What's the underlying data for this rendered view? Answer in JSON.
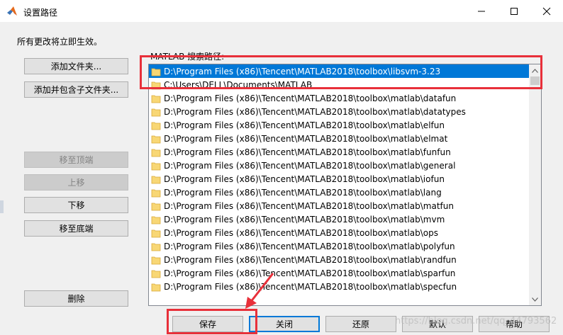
{
  "window": {
    "title": "设置路径",
    "icon": "matlab-logo-icon",
    "controls": [
      "minimize-icon",
      "maximize-icon",
      "close-icon"
    ]
  },
  "notice": "所有更改将立即生效。",
  "left_buttons": {
    "add_folder": "添加文件夹...",
    "add_with_subfolders": "添加并包含子文件夹...",
    "move_to_top": "移至顶端",
    "move_up": "上移",
    "move_down": "下移",
    "move_to_bottom": "移至底端",
    "remove": "删除"
  },
  "path_label": "MATLAB 搜索路径:",
  "paths": [
    {
      "text": "D:\\Program Files (x86)\\Tencent\\MATLAB2018\\toolbox\\libsvm-3.23",
      "selected": true
    },
    {
      "text": "C:\\Users\\DELL\\Documents\\MATLAB",
      "selected": false
    },
    {
      "text": "D:\\Program Files (x86)\\Tencent\\MATLAB2018\\toolbox\\matlab\\datafun",
      "selected": false
    },
    {
      "text": "D:\\Program Files (x86)\\Tencent\\MATLAB2018\\toolbox\\matlab\\datatypes",
      "selected": false
    },
    {
      "text": "D:\\Program Files (x86)\\Tencent\\MATLAB2018\\toolbox\\matlab\\elfun",
      "selected": false
    },
    {
      "text": "D:\\Program Files (x86)\\Tencent\\MATLAB2018\\toolbox\\matlab\\elmat",
      "selected": false
    },
    {
      "text": "D:\\Program Files (x86)\\Tencent\\MATLAB2018\\toolbox\\matlab\\funfun",
      "selected": false
    },
    {
      "text": "D:\\Program Files (x86)\\Tencent\\MATLAB2018\\toolbox\\matlab\\general",
      "selected": false
    },
    {
      "text": "D:\\Program Files (x86)\\Tencent\\MATLAB2018\\toolbox\\matlab\\iofun",
      "selected": false
    },
    {
      "text": "D:\\Program Files (x86)\\Tencent\\MATLAB2018\\toolbox\\matlab\\lang",
      "selected": false
    },
    {
      "text": "D:\\Program Files (x86)\\Tencent\\MATLAB2018\\toolbox\\matlab\\matfun",
      "selected": false
    },
    {
      "text": "D:\\Program Files (x86)\\Tencent\\MATLAB2018\\toolbox\\matlab\\mvm",
      "selected": false
    },
    {
      "text": "D:\\Program Files (x86)\\Tencent\\MATLAB2018\\toolbox\\matlab\\ops",
      "selected": false
    },
    {
      "text": "D:\\Program Files (x86)\\Tencent\\MATLAB2018\\toolbox\\matlab\\polyfun",
      "selected": false
    },
    {
      "text": "D:\\Program Files (x86)\\Tencent\\MATLAB2018\\toolbox\\matlab\\randfun",
      "selected": false
    },
    {
      "text": "D:\\Program Files (x86)\\Tencent\\MATLAB2018\\toolbox\\matlab\\sparfun",
      "selected": false
    },
    {
      "text": "D:\\Program Files (x86)\\Tencent\\MATLAB2018\\toolbox\\matlab\\specfun",
      "selected": false
    }
  ],
  "bottom_buttons": {
    "save": "保存",
    "close": "关闭",
    "restore": "还原",
    "default": "默认",
    "help": "帮助"
  },
  "watermark": "https://blog.csdn.net/qq_44793562",
  "colors": {
    "selection": "#0078d7",
    "annotation_red": "#e8303a",
    "folder_yellow": "#f8d775"
  }
}
